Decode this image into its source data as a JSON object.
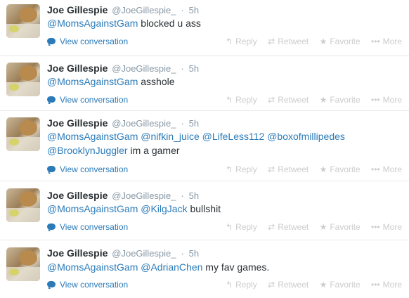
{
  "tweets": [
    {
      "name": "Joe Gillespie",
      "handle": "@JoeGillespie_",
      "separator": "·",
      "time": "5h",
      "mentions": [
        "@MomsAgainstGam"
      ],
      "text_line2": "",
      "body": "blocked u ass",
      "view_conversation": "View conversation",
      "actions": {
        "reply": "Reply",
        "retweet": "Retweet",
        "favorite": "Favorite",
        "more": "More"
      }
    },
    {
      "name": "Joe Gillespie",
      "handle": "@JoeGillespie_",
      "separator": "·",
      "time": "5h",
      "mentions": [
        "@MomsAgainstGam"
      ],
      "body": "asshole",
      "view_conversation": "View conversation",
      "actions": {
        "reply": "Reply",
        "retweet": "Retweet",
        "favorite": "Favorite",
        "more": "More"
      }
    },
    {
      "name": "Joe Gillespie",
      "handle": "@JoeGillespie_",
      "separator": "·",
      "time": "5h",
      "mentions": [
        "@MomsAgainstGam",
        "@nifkin_juice",
        "@LifeLess112",
        "@boxofmillipedes",
        "@BrooklynJuggler"
      ],
      "body": "im a gamer",
      "view_conversation": "View conversation",
      "actions": {
        "reply": "Reply",
        "retweet": "Retweet",
        "favorite": "Favorite",
        "more": "More"
      }
    },
    {
      "name": "Joe Gillespie",
      "handle": "@JoeGillespie_",
      "separator": "·",
      "time": "5h",
      "mentions": [
        "@MomsAgainstGam",
        "@KilgJack"
      ],
      "body": "bullshit",
      "view_conversation": "View conversation",
      "actions": {
        "reply": "Reply",
        "retweet": "Retweet",
        "favorite": "Favorite",
        "more": "More"
      }
    },
    {
      "name": "Joe Gillespie",
      "handle": "@JoeGillespie_",
      "separator": "·",
      "time": "5h",
      "mentions": [
        "@MomsAgainstGam",
        "@AdrianChen"
      ],
      "body": "my fav games.",
      "view_conversation": "View conversation",
      "actions": {
        "reply": "Reply",
        "retweet": "Retweet",
        "favorite": "Favorite",
        "more": "More"
      }
    }
  ],
  "colors": {
    "link": "#2b7bb9",
    "muted": "#8899a6",
    "action": "#cccccc",
    "text": "#292f33"
  },
  "icons": {
    "reply": "reply-arrow-icon",
    "retweet": "retweet-arrows-icon",
    "favorite": "star-icon",
    "more": "ellipsis-icon",
    "conversation": "speech-bubble-icon"
  }
}
